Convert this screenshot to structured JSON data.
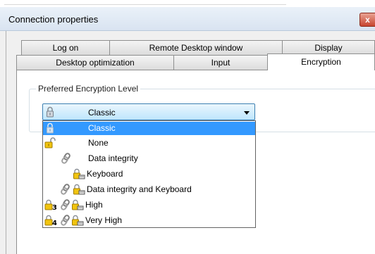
{
  "window": {
    "title": "Connection properties",
    "close_label": "x"
  },
  "tabs_row1": [
    {
      "label": "Log on"
    },
    {
      "label": "Remote Desktop window"
    },
    {
      "label": "Display"
    }
  ],
  "tabs_row2": [
    {
      "label": "Desktop optimization"
    },
    {
      "label": "Input"
    },
    {
      "label": "Encryption"
    }
  ],
  "active_tab": "Encryption",
  "group": {
    "label": "Preferred Encryption Level"
  },
  "combo": {
    "selected": "Classic",
    "selected_icon": "padlock-closed-icon"
  },
  "options": [
    {
      "label": "Classic",
      "icons": [
        "padlock-closed-icon"
      ],
      "selected": true
    },
    {
      "label": "None",
      "icons": [
        "padlock-open-icon"
      ],
      "selected": false
    },
    {
      "label": "Data integrity",
      "icons": [
        "chain-link-icon"
      ],
      "selected": false
    },
    {
      "label": "Keyboard",
      "icons": [
        "keyboard-lock-icon"
      ],
      "selected": false
    },
    {
      "label": "Data integrity and Keyboard",
      "icons": [
        "chain-link-icon",
        "keyboard-lock-icon"
      ],
      "selected": false
    },
    {
      "label": "High",
      "icons": [
        "level-3-lock-icon",
        "chain-link-icon",
        "keyboard-lock-icon"
      ],
      "badge": "3",
      "selected": false
    },
    {
      "label": "Very High",
      "icons": [
        "level-4-lock-icon",
        "chain-link-icon",
        "keyboard-lock-icon"
      ],
      "badge": "4",
      "selected": false
    }
  ],
  "colors": {
    "selection": "#3399ff",
    "lock_gold": "#e8b800",
    "close_red": "#c8452f"
  }
}
